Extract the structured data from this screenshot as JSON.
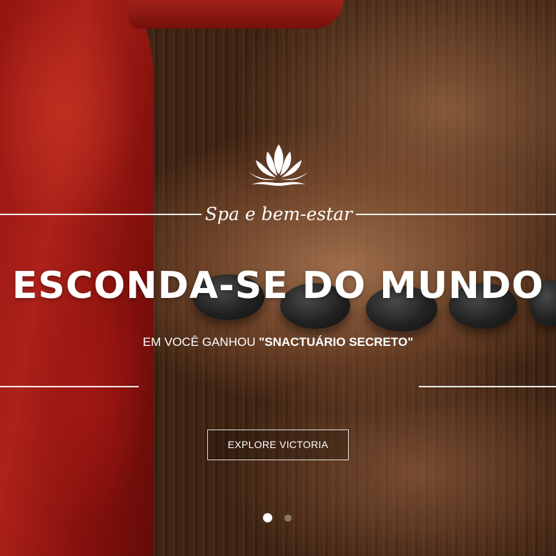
{
  "hero": {
    "tagline": "Spa e bem-estar",
    "headline": "ESCONDA-SE DO MUNDO",
    "subline_prefix": "EM VOCÊ GANHOU ",
    "subline_highlight": "\"SNACTUÁRIO SECRETO\"",
    "cta_label": "EXPLORE VICTORIA",
    "logo_icon": "lotus-icon"
  },
  "slider": {
    "total_slides": 2,
    "active_slide": 1
  },
  "colors": {
    "text": "#ffffff",
    "accent_cloth": "#c72a1e"
  }
}
